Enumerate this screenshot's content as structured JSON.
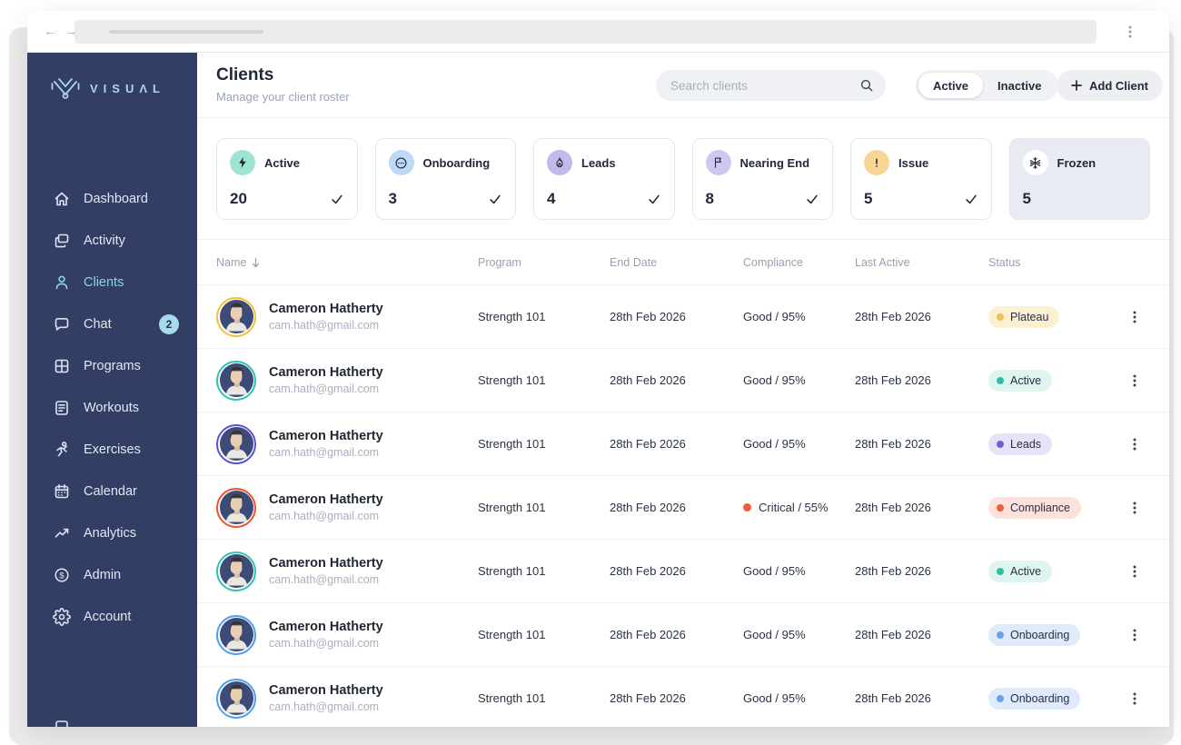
{
  "brand": {
    "name": "VISUΛL",
    "accent": "#a9d6f2"
  },
  "sidebar": {
    "items": [
      {
        "label": "Dashboard",
        "icon": "home-icon"
      },
      {
        "label": "Activity",
        "icon": "activity-icon"
      },
      {
        "label": "Clients",
        "icon": "clients-icon",
        "active": true
      },
      {
        "label": "Chat",
        "icon": "chat-icon",
        "badge": "2"
      },
      {
        "label": "Programs",
        "icon": "programs-icon"
      },
      {
        "label": "Workouts",
        "icon": "workouts-icon"
      },
      {
        "label": "Exercises",
        "icon": "exercises-icon"
      },
      {
        "label": "Calendar",
        "icon": "calendar-icon"
      },
      {
        "label": "Analytics",
        "icon": "analytics-icon"
      },
      {
        "label": "Admin",
        "icon": "admin-icon"
      },
      {
        "label": "Account",
        "icon": "account-icon"
      }
    ]
  },
  "header": {
    "title": "Clients",
    "subtitle": "Manage your client roster",
    "search_placeholder": "Search clients",
    "toggle": {
      "active_label": "Active",
      "inactive_label": "Inactive",
      "selected": "Active"
    },
    "add_client_label": "Add Client"
  },
  "stats": [
    {
      "label": "Active",
      "count": "20",
      "icon": "bolt-icon",
      "icon_bg": "#9de4d3",
      "checked": true
    },
    {
      "label": "Onboarding",
      "count": "3",
      "icon": "ellipsis-face-icon",
      "icon_bg": "#bcd9f8",
      "checked": true
    },
    {
      "label": "Leads",
      "count": "4",
      "icon": "flame-icon",
      "icon_bg": "#c4b9ec",
      "checked": true
    },
    {
      "label": "Nearing End",
      "count": "8",
      "icon": "flag-icon",
      "icon_bg": "#cfc6f2",
      "checked": true
    },
    {
      "label": "Issue",
      "count": "5",
      "icon": "exclamation-icon",
      "icon_bg": "#f7d694",
      "checked": true
    },
    {
      "label": "Frozen",
      "count": "5",
      "icon": "snowflake-icon",
      "icon_bg": "#ffffff",
      "card_bg": "#e9ebf2"
    }
  ],
  "table": {
    "columns": [
      "Name",
      "Program",
      "End Date",
      "Compliance",
      "Last Active",
      "Status"
    ],
    "rows": [
      {
        "name": "Cameron Hatherty",
        "email": "cam.hath@gmail.com",
        "program": "Strength 101",
        "end_date": "28th Feb 2026",
        "compliance": "Good / 95%",
        "last_active": "28th Feb 2026",
        "status": "Plateau",
        "status_bg": "#fcf0d3",
        "status_dot": "#f2c14e",
        "ring": "#f0c237"
      },
      {
        "name": "Cameron Hatherty",
        "email": "cam.hath@gmail.com",
        "program": "Strength 101",
        "end_date": "28th Feb 2026",
        "compliance": "Good / 95%",
        "last_active": "28th Feb 2026",
        "status": "Active",
        "status_bg": "#def4ee",
        "status_dot": "#2dbfa4",
        "ring": "#2ec4ae"
      },
      {
        "name": "Cameron Hatherty",
        "email": "cam.hath@gmail.com",
        "program": "Strength 101",
        "end_date": "28th Feb 2026",
        "compliance": "Good / 95%",
        "last_active": "28th Feb 2026",
        "status": "Leads",
        "status_bg": "#e7e2f7",
        "status_dot": "#6f5fd4",
        "ring": "#5b50d6"
      },
      {
        "name": "Cameron Hatherty",
        "email": "cam.hath@gmail.com",
        "program": "Strength 101",
        "end_date": "28th Feb 2026",
        "compliance": "Critical / 55%",
        "critical": true,
        "critical_color": "#f25b3a",
        "last_active": "28th Feb 2026",
        "status": "Compliance",
        "status_bg": "#fce2da",
        "status_dot": "#f25b3a",
        "ring": "#f0502a"
      },
      {
        "name": "Cameron Hatherty",
        "email": "cam.hath@gmail.com",
        "program": "Strength 101",
        "end_date": "28th Feb 2026",
        "compliance": "Good / 95%",
        "last_active": "28th Feb 2026",
        "status": "Active",
        "status_bg": "#def4ee",
        "status_dot": "#2dbfa4",
        "ring": "#2ec4ae"
      },
      {
        "name": "Cameron Hatherty",
        "email": "cam.hath@gmail.com",
        "program": "Strength 101",
        "end_date": "28th Feb 2026",
        "compliance": "Good / 95%",
        "last_active": "28th Feb 2026",
        "status": "Onboarding",
        "status_bg": "#dfeafb",
        "status_dot": "#66a3ee",
        "ring": "#4aa0f2"
      },
      {
        "name": "Cameron Hatherty",
        "email": "cam.hath@gmail.com",
        "program": "Strength 101",
        "end_date": "28th Feb 2026",
        "compliance": "Good / 95%",
        "last_active": "28th Feb 2026",
        "status": "Onboarding",
        "status_bg": "#dfeafb",
        "status_dot": "#66a3ee",
        "ring": "#4aa0f2"
      }
    ]
  }
}
